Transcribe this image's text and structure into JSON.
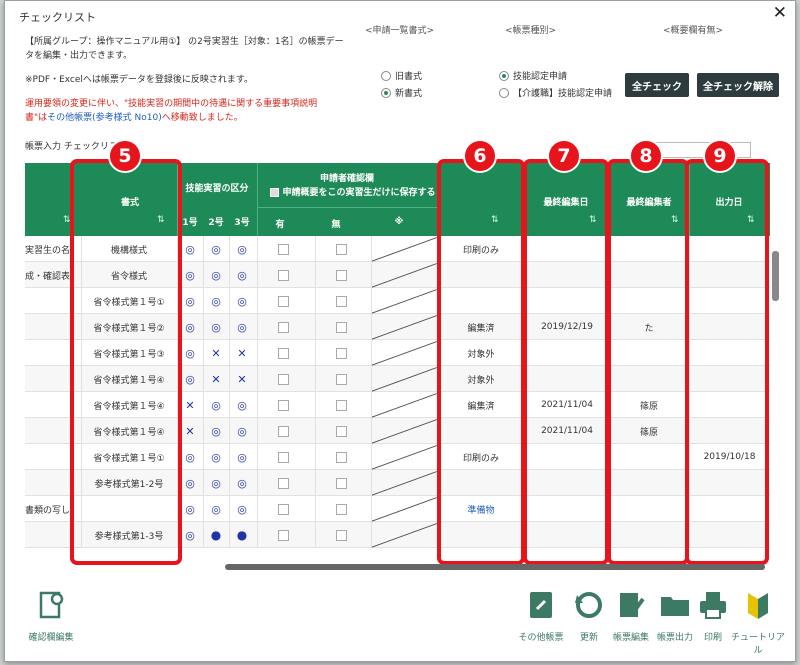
{
  "window": {
    "title": "チェックリスト"
  },
  "info": {
    "line1": "【所属グループ：操作マニュアル用①】 の2号実習生［対象：1名］の帳票デー",
    "line2": "タを編集・出力できます。",
    "pdf_note": "※PDF・Excelへは帳票データを登録後に反映されます。",
    "red_line1": "運用要領の変更に伴い、\"技能実習の期間中の待遇に関する重要事項説明",
    "red_line2_a": "書\"は",
    "red_line2_link": "その他帳票(参考様式 No10)",
    "red_line2_b": "へ移動致しました。"
  },
  "header_groups": {
    "apply_list_format": "<申請一覧書式>",
    "form_type": "<帳票種別>",
    "summary_column": "<概要欄有無>"
  },
  "options": {
    "old_format": "旧書式",
    "new_format": "新書式",
    "skill_cert": "技能認定申請",
    "care_skill_cert": "【介護職】技能認定申請"
  },
  "buttons": {
    "check_all": "全チェック",
    "uncheck_all": "全チェック解除"
  },
  "list_label": "帳票入力 チェックリスト",
  "table": {
    "columns": {
      "format": "書式",
      "skill_group": "技能実習の区分",
      "no1": "1号",
      "no2": "2号",
      "no3": "3号",
      "applicant_confirm": "申請者確認欄",
      "save_all": "申請概要をこの実習生だけに保存する",
      "yes": "有",
      "no": "無",
      "note": "※",
      "status": "",
      "last_edit_date": "最終編集日",
      "last_editor": "最終編集者",
      "output_date": "出力日"
    },
    "left_fragments": [
      "実習生の名",
      "",
      "",
      "",
      "",
      "",
      "",
      "",
      "",
      "",
      "",
      "",
      "",
      "",
      "",
      "",
      "",
      "",
      "",
      "",
      "",
      "",
      "",
      "",
      ""
    ],
    "rows": [
      {
        "left": "実習生の名",
        "format": "機構様式",
        "m1": "◎",
        "m2": "◎",
        "m3": "◎",
        "status": "印刷のみ",
        "date": "",
        "editor": "",
        "out": ""
      },
      {
        "left": "成・確認表",
        "format": "省令様式",
        "m1": "◎",
        "m2": "◎",
        "m3": "◎",
        "status": "",
        "date": "",
        "editor": "",
        "out": ""
      },
      {
        "left": "",
        "format": "省令様式第１号①",
        "m1": "◎",
        "m2": "◎",
        "m3": "◎",
        "status": "",
        "date": "",
        "editor": "",
        "out": ""
      },
      {
        "left": "",
        "format": "省令様式第１号②",
        "m1": "◎",
        "m2": "◎",
        "m3": "◎",
        "status": "編集済",
        "date": "2019/12/19",
        "editor": "た",
        "out": ""
      },
      {
        "left": "",
        "format": "省令様式第１号③",
        "m1": "◎",
        "m2": "✕",
        "m3": "✕",
        "status": "対象外",
        "date": "",
        "editor": "",
        "out": ""
      },
      {
        "left": "",
        "format": "省令様式第１号④",
        "m1": "◎",
        "m2": "✕",
        "m3": "✕",
        "status": "対象外",
        "date": "",
        "editor": "",
        "out": ""
      },
      {
        "left": "",
        "format": "省令様式第１号④",
        "m1": "✕",
        "m2": "◎",
        "m3": "◎",
        "status": "編集済",
        "date": "2021/11/04",
        "editor": "篠原",
        "out": ""
      },
      {
        "left": "",
        "format": "省令様式第１号④",
        "m1": "✕",
        "m2": "◎",
        "m3": "◎",
        "status": "",
        "date": "2021/11/04",
        "editor": "篠原",
        "out": ""
      },
      {
        "left": "",
        "format": "省令様式第１号①",
        "m1": "◎",
        "m2": "◎",
        "m3": "◎",
        "status": "印刷のみ",
        "date": "",
        "editor": "",
        "out": "2019/10/18"
      },
      {
        "left": "",
        "format": "参考様式第1-2号",
        "m1": "◎",
        "m2": "◎",
        "m3": "◎",
        "status": "",
        "date": "",
        "editor": "",
        "out": ""
      },
      {
        "left": "書類の写し",
        "format": "",
        "m1": "◎",
        "m2": "◎",
        "m3": "◎",
        "status": "準備物",
        "date": "",
        "editor": "",
        "out": ""
      },
      {
        "left": "",
        "format": "参考様式第1-3号",
        "m1": "◎",
        "m2": "●",
        "m3": "●",
        "status": "",
        "date": "",
        "editor": "",
        "out": ""
      }
    ]
  },
  "badges": [
    "5",
    "6",
    "7",
    "8",
    "9"
  ],
  "toolbar": {
    "confirm_edit": "確認欄編集",
    "other_forms": "その他帳票",
    "refresh": "更新",
    "form_edit": "帳票編集",
    "form_output": "帳票出力",
    "print": "印刷",
    "tutorial": "チュートリアル"
  },
  "colors": {
    "header_green": "#1e8a58",
    "highlight_red": "#e8141b",
    "mark_blue": "#2233a8",
    "dark_button": "#2e3c3f"
  }
}
